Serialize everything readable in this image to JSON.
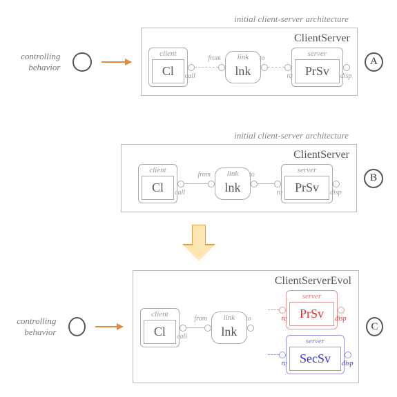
{
  "labels": {
    "initial_arch": "initial client-server architecture",
    "controlling": "controlling behavior"
  },
  "boxA": {
    "title": "ClientServer",
    "client": {
      "label": "client",
      "name": "Cl",
      "port": "call"
    },
    "link": {
      "label": "link",
      "name": "lnk",
      "from": "from",
      "to": "to"
    },
    "server": {
      "label": "server",
      "name": "PrSv",
      "rq": "rq",
      "disp": "disp"
    }
  },
  "boxB": {
    "title": "ClientServer",
    "client": {
      "label": "client",
      "name": "Cl",
      "port": "call"
    },
    "link": {
      "label": "link",
      "name": "lnk",
      "from": "from",
      "to": "to"
    },
    "server": {
      "label": "server",
      "name": "PrSv",
      "rq": "rq",
      "disp": "disp"
    }
  },
  "boxC": {
    "title": "ClientServerEvol",
    "client": {
      "label": "client",
      "name": "Cl",
      "port": "call"
    },
    "link": {
      "label": "link",
      "name": "lnk",
      "from": "from",
      "to": "to"
    },
    "server1": {
      "label": "server",
      "name": "PrSv",
      "rq": "rq",
      "disp": "disp"
    },
    "server2": {
      "label": "server",
      "name": "SecSv",
      "rq": "rq",
      "disp": "disp"
    }
  },
  "badges": {
    "A": "A",
    "B": "B",
    "C": "C"
  }
}
